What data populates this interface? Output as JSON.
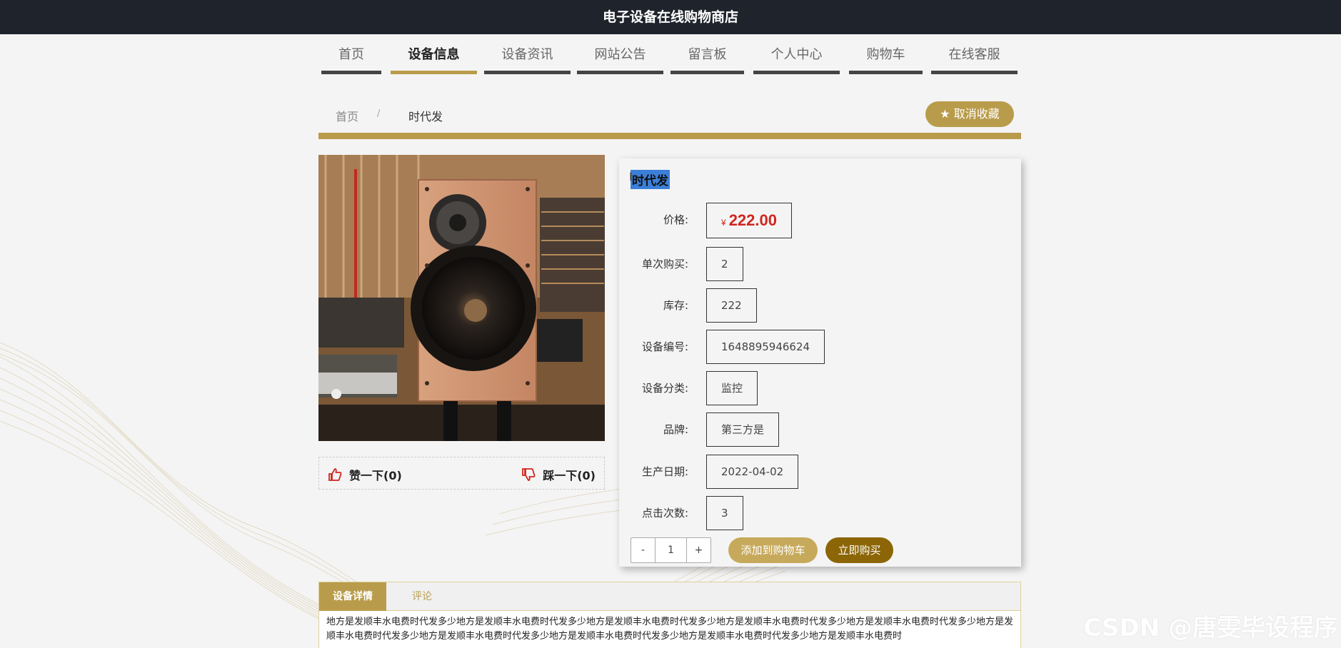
{
  "site": {
    "title": "电子设备在线购物商店"
  },
  "nav": {
    "items": [
      {
        "label": "首页"
      },
      {
        "label": "设备信息"
      },
      {
        "label": "设备资讯"
      },
      {
        "label": "网站公告"
      },
      {
        "label": "留言板"
      },
      {
        "label": "个人中心"
      },
      {
        "label": "购物车"
      },
      {
        "label": "在线客服"
      }
    ],
    "active": "设备信息"
  },
  "breadcrumb": {
    "home": "首页",
    "separator": "/",
    "current": "时代发"
  },
  "favorite_button": {
    "label": "取消收藏",
    "icon": "star-icon"
  },
  "product": {
    "title": "时代发",
    "image_alt": "bookshelf speaker in wooden cabinet",
    "fields": [
      {
        "label": "价格:",
        "value": "222.00",
        "currency": "¥"
      },
      {
        "label": "单次购买:",
        "value": "2"
      },
      {
        "label": "库存:",
        "value": "222"
      },
      {
        "label": "设备编号:",
        "value": "1648895946624"
      },
      {
        "label": "设备分类:",
        "value": "监控"
      },
      {
        "label": "品牌:",
        "value": "第三方是"
      },
      {
        "label": "生产日期:",
        "value": "2022-04-02"
      },
      {
        "label": "点击次数:",
        "value": "3"
      }
    ]
  },
  "votes": {
    "up_label": "赞一下(0)",
    "down_label": "踩一下(0)"
  },
  "quantity": {
    "minus": "-",
    "value": "1",
    "plus": "+"
  },
  "actions": {
    "add_to_cart": "添加到购物车",
    "buy_now": "立即购买"
  },
  "tabs": {
    "detail": "设备详情",
    "review": "评论"
  },
  "description": "地方是发顺丰水电费时代发多少地方是发顺丰水电费时代发多少地方是发顺丰水电费时代发多少地方是发顺丰水电费时代发多少地方是发顺丰水电费时代发多少地方是发顺丰水电费时代发多少地方是发顺丰水电费时代发多少地方是发顺丰水电费时代发多少地方是发顺丰水电费时代发多少地方是发顺丰水电费时",
  "watermark": "CSDN @唐雯毕设程序",
  "colors": {
    "accent": "#b99c4b",
    "topbar": "#1f242c",
    "price": "#d0261f",
    "buy": "#8c6606"
  }
}
